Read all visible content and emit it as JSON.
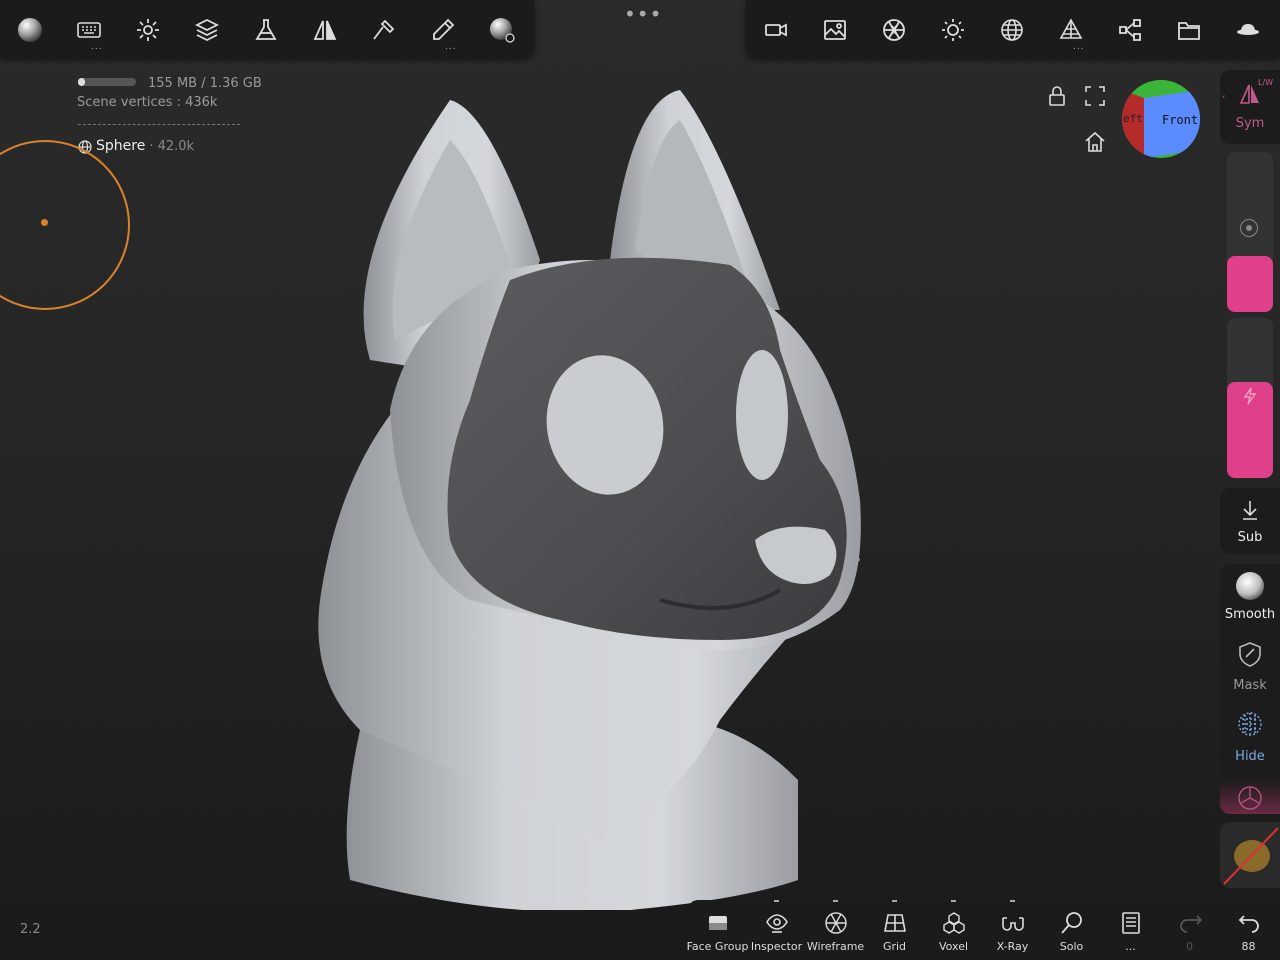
{
  "colors": {
    "brush": "#d7832b",
    "accent_pink": "#e0408a",
    "sym_accent": "#c05a8a",
    "hide_accent": "#7aa8e0"
  },
  "top_toolbar": {
    "left_icons": [
      "matcap-sphere-icon",
      "keyboard-icon",
      "gear-icon",
      "layers-icon",
      "flask-icon",
      "symmetry-icon",
      "hammer-icon",
      "pen-icon",
      "material-sphere-icon"
    ],
    "right_icons": [
      "camera-icon",
      "image-icon",
      "aperture-icon",
      "sun-icon",
      "globe-grid-icon",
      "pyramid-icon",
      "share-nodes-icon",
      "folder-icon",
      "cap-icon"
    ],
    "more": "..."
  },
  "scene_info": {
    "memory": "155 MB / 1.36 GB",
    "memory_fraction": 0.12,
    "vertices": "Scene vertices :  436k",
    "mesh_name": "Sphere",
    "mesh_verts": "· 42.0k"
  },
  "view_cube": {
    "front": "Front",
    "left": "eft"
  },
  "right_panel": {
    "sym": {
      "label": "Sym",
      "corner": "L/W"
    },
    "sub": {
      "label": "Sub"
    },
    "tools": [
      {
        "label": "Smooth",
        "icon": "smooth-ball-icon"
      },
      {
        "label": "Mask",
        "icon": "mask-shield-icon"
      },
      {
        "label": "Hide",
        "icon": "hide-grid-icon"
      }
    ],
    "radius_fraction": 0.35,
    "intensity_fraction": 0.6
  },
  "bottom_toolbar": {
    "items": [
      {
        "label": "Face Group",
        "icon": "face-group-icon"
      },
      {
        "label": "Inspector",
        "icon": "inspector-eye-icon"
      },
      {
        "label": "Wireframe",
        "icon": "wireframe-icon"
      },
      {
        "label": "Grid",
        "icon": "grid-icon"
      },
      {
        "label": "Voxel",
        "icon": "voxel-icon"
      },
      {
        "label": "X-Ray",
        "icon": "xray-glasses-icon"
      },
      {
        "label": "Solo",
        "icon": "solo-magnifier-icon"
      },
      {
        "label": "...",
        "icon": "page-icon"
      },
      {
        "label": "0",
        "icon": "redo-icon"
      },
      {
        "label": "88",
        "icon": "undo-icon"
      }
    ]
  },
  "version": "2.2"
}
